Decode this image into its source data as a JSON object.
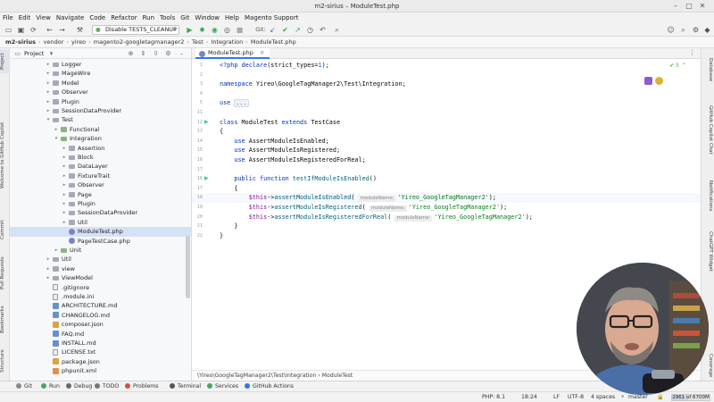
{
  "window": {
    "title": "m2-sirius – ModuleTest.php"
  },
  "menu": [
    "File",
    "Edit",
    "View",
    "Navigate",
    "Code",
    "Refactor",
    "Run",
    "Tools",
    "Git",
    "Window",
    "Help",
    "Magento Support"
  ],
  "toolbar": {
    "run_config": "Disable TESTS_CLEANUP",
    "git_label": "Git:"
  },
  "breadcrumb": [
    "m2-sirius",
    "vendor",
    "yireo",
    "magento2-googletagmanager2",
    "Test",
    "Integration",
    "ModuleTest.php"
  ],
  "left_strip": [
    "Project",
    "Welcome to GitHub Copilot",
    "Commit",
    "Pull Requests",
    "Bookmarks",
    "Structure"
  ],
  "project_panel": {
    "title": "Project",
    "tree": [
      {
        "label": "Logger",
        "kind": "folder",
        "depth": 4,
        "arrow": "▸"
      },
      {
        "label": "MageWire",
        "kind": "folder",
        "depth": 4,
        "arrow": "▸"
      },
      {
        "label": "Model",
        "kind": "folder",
        "depth": 4,
        "arrow": "▸"
      },
      {
        "label": "Observer",
        "kind": "folder",
        "depth": 4,
        "arrow": "▸"
      },
      {
        "label": "Plugin",
        "kind": "folder",
        "depth": 4,
        "arrow": "▸"
      },
      {
        "label": "SessionDataProvider",
        "kind": "folder",
        "depth": 4,
        "arrow": "▸"
      },
      {
        "label": "Test",
        "kind": "folder",
        "depth": 4,
        "arrow": "▾"
      },
      {
        "label": "Functional",
        "kind": "folder test",
        "depth": 5,
        "arrow": "▸"
      },
      {
        "label": "Integration",
        "kind": "folder test",
        "depth": 5,
        "arrow": "▾"
      },
      {
        "label": "Assertion",
        "kind": "folder",
        "depth": 6,
        "arrow": "▸"
      },
      {
        "label": "Block",
        "kind": "folder",
        "depth": 6,
        "arrow": "▸"
      },
      {
        "label": "DataLayer",
        "kind": "folder",
        "depth": 6,
        "arrow": "▸"
      },
      {
        "label": "FixtureTrait",
        "kind": "folder",
        "depth": 6,
        "arrow": "▸"
      },
      {
        "label": "Observer",
        "kind": "folder",
        "depth": 6,
        "arrow": "▸"
      },
      {
        "label": "Page",
        "kind": "folder",
        "depth": 6,
        "arrow": "▸"
      },
      {
        "label": "Plugin",
        "kind": "folder",
        "depth": 6,
        "arrow": "▸"
      },
      {
        "label": "SessionDataProvider",
        "kind": "folder",
        "depth": 6,
        "arrow": "▸"
      },
      {
        "label": "Util",
        "kind": "folder",
        "depth": 6,
        "arrow": "▸"
      },
      {
        "label": "ModuleTest.php",
        "kind": "php",
        "depth": 6,
        "arrow": "",
        "selected": true
      },
      {
        "label": "PageTestCase.php",
        "kind": "php",
        "depth": 6,
        "arrow": ""
      },
      {
        "label": "Unit",
        "kind": "folder test",
        "depth": 5,
        "arrow": "▸"
      },
      {
        "label": "Util",
        "kind": "folder",
        "depth": 4,
        "arrow": "▸"
      },
      {
        "label": "view",
        "kind": "folder",
        "depth": 4,
        "arrow": "▸"
      },
      {
        "label": "ViewModel",
        "kind": "folder",
        "depth": 4,
        "arrow": "▸"
      },
      {
        "label": ".gitignore",
        "kind": "txt",
        "depth": 4,
        "arrow": ""
      },
      {
        "label": ".module.ini",
        "kind": "txt",
        "depth": 4,
        "arrow": ""
      },
      {
        "label": "ARCHITECTURE.md",
        "kind": "md",
        "depth": 4,
        "arrow": ""
      },
      {
        "label": "CHANGELOG.md",
        "kind": "md",
        "depth": 4,
        "arrow": ""
      },
      {
        "label": "composer.json",
        "kind": "json",
        "depth": 4,
        "arrow": ""
      },
      {
        "label": "FAQ.md",
        "kind": "md",
        "depth": 4,
        "arrow": ""
      },
      {
        "label": "INSTALL.md",
        "kind": "md",
        "depth": 4,
        "arrow": ""
      },
      {
        "label": "LICENSE.txt",
        "kind": "txt",
        "depth": 4,
        "arrow": ""
      },
      {
        "label": "package.json",
        "kind": "json",
        "depth": 4,
        "arrow": ""
      },
      {
        "label": "phpunit.xml",
        "kind": "xml",
        "depth": 4,
        "arrow": ""
      }
    ]
  },
  "editor": {
    "tab": "ModuleTest.php",
    "inspection_count": "5",
    "current_line": 18,
    "lines": [
      {
        "n": "1",
        "html": "<span class='k'>&lt;?php</span> <span class='k'>declare</span>(strict_types=<span class='n'>1</span>);"
      },
      {
        "n": "2",
        "html": ""
      },
      {
        "n": "3",
        "html": "<span class='k'>namespace</span> Yireo\\GoogleTagManager2\\Test\\Integration;"
      },
      {
        "n": "4",
        "html": ""
      },
      {
        "n": "5",
        "html": "<span class='k'>use</span> <span class='fold'>...</span>"
      },
      {
        "n": "11",
        "html": ""
      },
      {
        "n": "12",
        "html": "<span class='k'>class</span> ModuleTest <span class='k'>extends</span> TestCase",
        "mark": "▶"
      },
      {
        "n": "13",
        "html": "{"
      },
      {
        "n": "14",
        "html": "    <span class='k'>use</span> AssertModuleIsEnabled;"
      },
      {
        "n": "15",
        "html": "    <span class='k'>use</span> AssertModuleIsRegistered;"
      },
      {
        "n": "16",
        "html": "    <span class='k'>use</span> AssertModuleIsRegisteredForReal;"
      },
      {
        "n": "17",
        "html": ""
      },
      {
        "n": "16",
        "html": "    <span class='k'>public function</span> <span class='f'>testIfModuleIsEnabled</span>()",
        "mark": "▶"
      },
      {
        "n": "17",
        "html": "    {"
      },
      {
        "n": "18",
        "html": "        <span class='v'>$this</span>-&gt;<span class='m'>assertModuleIsEnabled</span>( <span class='hint'>moduleName:</span><span class='s'>'Yireo_GoogleTagManager2'</span>);"
      },
      {
        "n": "19",
        "html": "        <span class='v'>$this</span>-&gt;<span class='m'>assertModuleIsRegistered</span>( <span class='hint'>moduleName:</span><span class='s'>'Yireo_GoogleTagManager2'</span>);"
      },
      {
        "n": "20",
        "html": "        <span class='v'>$this</span>-&gt;<span class='m'>assertModuleIsRegisteredForReal</span>( <span class='hint'>moduleName:</span><span class='s'>'Yireo_GoogleTagManager2'</span>);"
      },
      {
        "n": "21",
        "html": "    }"
      },
      {
        "n": "22",
        "html": "}"
      }
    ],
    "breadcrumb": "\\Yireo\\GoogleTagManager2\\Test\\Integration  ›  ModuleTest"
  },
  "right_strip": [
    "Database",
    "GitHub Copilot Chat",
    "Notifications",
    "ChatGPT Widget",
    "Coverage"
  ],
  "tool_windows": [
    {
      "label": "Git",
      "color": "#888888"
    },
    {
      "label": "Run",
      "color": "#4aa564"
    },
    {
      "label": "Debug",
      "color": "#6a6a6a"
    },
    {
      "label": "TODO",
      "color": "#777777"
    },
    {
      "label": "Problems",
      "color": "#d05050"
    },
    {
      "label": "Terminal",
      "color": "#555555"
    },
    {
      "label": "Services",
      "color": "#4aa564"
    },
    {
      "label": "GitHub Actions",
      "color": "#3574f0"
    }
  ],
  "status": {
    "php": "PHP: 8.1",
    "position": "18:24",
    "line_sep": "LF",
    "encoding": "UTF-8",
    "indent": "4 spaces",
    "branch": "master",
    "memory": "2961 of 6700M",
    "memory_fraction": 0.44
  }
}
